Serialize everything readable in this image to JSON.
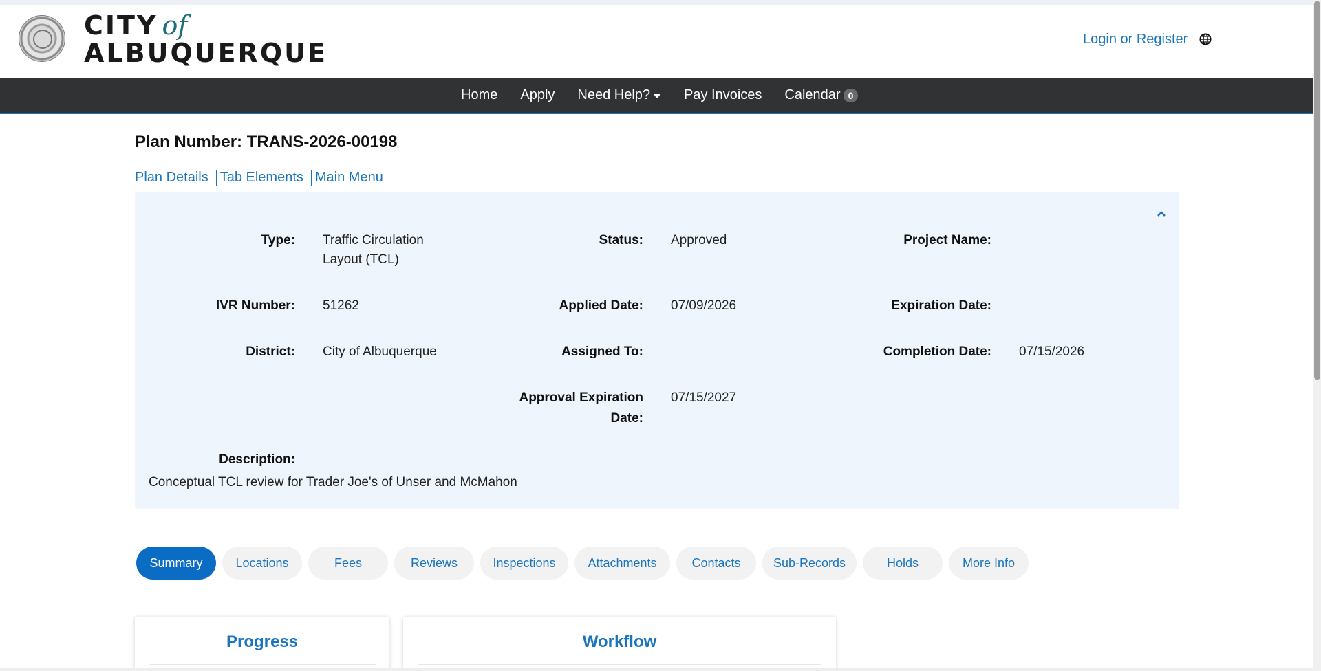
{
  "header": {
    "logo": {
      "line1_prefix": "CITY",
      "line1_suffix": "of",
      "line2": "ALBUQUERQUE"
    },
    "login_label": "Login or Register",
    "language_icon": "globe-icon"
  },
  "nav": {
    "items": [
      {
        "label": "Home"
      },
      {
        "label": "Apply"
      },
      {
        "label": "Need Help?",
        "has_dropdown": true
      },
      {
        "label": "Pay Invoices"
      },
      {
        "label": "Calendar",
        "badge": "0"
      }
    ]
  },
  "plan": {
    "title": "Plan Number: TRANS-2026-00198",
    "subnav": [
      "Plan Details",
      "Tab Elements",
      "Main Menu"
    ]
  },
  "details": {
    "type_label": "Type:",
    "type_value": "Traffic Circulation Layout (TCL)",
    "status_label": "Status:",
    "status_value": "Approved",
    "project_name_label": "Project Name:",
    "project_name_value": "",
    "ivr_label": "IVR Number:",
    "ivr_value": "51262",
    "applied_label": "Applied Date:",
    "applied_value": "07/09/2026",
    "expiration_label": "Expiration Date:",
    "expiration_value": "",
    "district_label": "District:",
    "district_value": "City of Albuquerque",
    "assigned_label": "Assigned To:",
    "assigned_value": "",
    "completion_label": "Completion Date:",
    "completion_value": "07/15/2026",
    "approval_exp_label": "Approval Expiration Date:",
    "approval_exp_value": "07/15/2027",
    "description_label": "Description:",
    "description_value": "Conceptual TCL review for Trader Joe's of Unser and McMahon"
  },
  "tabs": [
    {
      "label": "Summary",
      "active": true
    },
    {
      "label": "Locations"
    },
    {
      "label": "Fees"
    },
    {
      "label": "Reviews"
    },
    {
      "label": "Inspections"
    },
    {
      "label": "Attachments"
    },
    {
      "label": "Contacts"
    },
    {
      "label": "Sub-Records"
    },
    {
      "label": "Holds"
    },
    {
      "label": "More Info"
    }
  ],
  "cards": {
    "progress_title": "Progress",
    "workflow_title": "Workflow"
  },
  "colors": {
    "link": "#1b75bc",
    "nav_bg": "#303233",
    "panel_bg": "#eef5fd",
    "active_tab": "#0b6cc4"
  }
}
